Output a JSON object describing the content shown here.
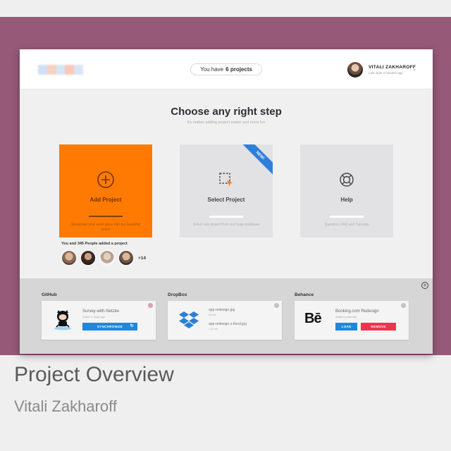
{
  "colors": {
    "frame": "#965a78",
    "accent_orange": "#fe7a02",
    "ribbon_blue": "#2e7fdb",
    "button_blue": "#1a8ae0",
    "button_red": "#f2324f"
  },
  "header": {
    "logo_icon": "blurred-logo",
    "projects_pill": {
      "prefix": "You have",
      "count": "6 projects"
    },
    "user": {
      "name": "VITALI ZAKHAROFF",
      "sub": "Last login 4 minutes ago"
    },
    "menu_icon": "chevron-down-icon"
  },
  "hero": {
    "title": "Choose any right step",
    "subtitle": "It's makes adding project easier and more fun"
  },
  "options": [
    {
      "label": "Add Project",
      "icon": "plus-circle-icon",
      "desc": "Showcase your work piece into our beautiful works"
    },
    {
      "label": "Select Project",
      "icon": "select-cursor-icon",
      "desc": "Select any project from our huge database",
      "badge": "NEW!"
    },
    {
      "label": "Help",
      "icon": "lifebuoy-icon",
      "desc": "Question, FAQ and Tutorials"
    }
  ],
  "community": {
    "label": "You and 345 People added a project",
    "more": "+14"
  },
  "services": {
    "github": {
      "title": "GitHub",
      "repo": "Survey-with-Netzke",
      "repo_sub": "Added 1 days ago",
      "button": "SYNCHRONIZE"
    },
    "dropbox": {
      "title": "DropBox",
      "file1": "app-redesign.jpg",
      "file1_sub": "612 kb",
      "file2": "app-redesign-z-flood.jpg",
      "file2_sub": "1.42 mb"
    },
    "behance": {
      "title": "Behance",
      "project": "Booking.com Redesign",
      "project_sub": "Added yesterday",
      "load": "LOAD",
      "remove": "REMOVE"
    }
  },
  "caption": {
    "title": "Project Overview",
    "author": "Vitali Zakharoff"
  }
}
